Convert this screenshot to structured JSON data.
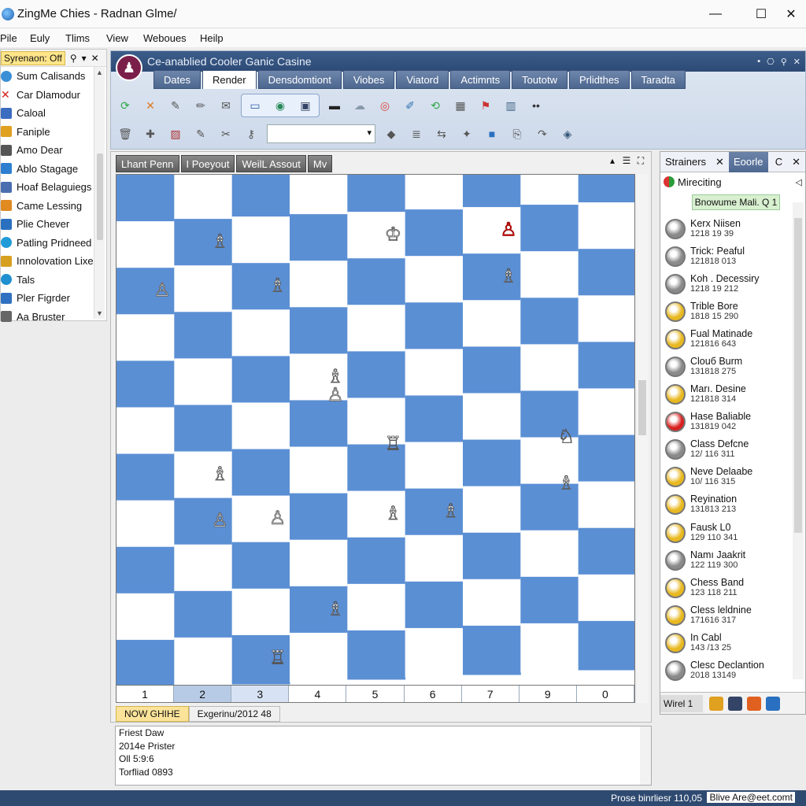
{
  "window": {
    "title": "ZingMe Chies - Radnan Glme/",
    "controls": [
      "—",
      "☐",
      "✕"
    ]
  },
  "menu": [
    "Pile",
    "Euly",
    "Tlims",
    "View",
    "Weboues",
    "Heilp"
  ],
  "left_panel": {
    "header_tag": "Syrenaon: Off",
    "header_controls": [
      "⚲",
      "▾",
      "✕"
    ],
    "items": [
      {
        "label": "Sum Calisands",
        "icon": "cloud-icon",
        "color": "#3b8fd6"
      },
      {
        "label": "Car Dlamodur",
        "icon": "cross-icon",
        "color": "#d02020"
      },
      {
        "label": "Caloal",
        "icon": "document-icon",
        "color": "#3a6cc0"
      },
      {
        "label": "Faniple",
        "icon": "folder-icon",
        "color": "#e0a020"
      },
      {
        "label": "Amo Dear",
        "icon": "person-icon",
        "color": "#555555"
      },
      {
        "label": "Ablo Stagage",
        "icon": "grid-icon",
        "color": "#2f7fd0"
      },
      {
        "label": "Hoaf Belaguiegs",
        "icon": "book-icon",
        "color": "#4a6fb0"
      },
      {
        "label": "Came Lessing",
        "icon": "game-icon",
        "color": "#e08a20"
      },
      {
        "label": "Plie Chever",
        "icon": "monitor-icon",
        "color": "#2a70c0"
      },
      {
        "label": "Patling Pridneed",
        "icon": "globe-icon",
        "color": "#1f9cd8"
      },
      {
        "label": "Innolovation Lixe",
        "icon": "star-icon",
        "color": "#d8a020"
      },
      {
        "label": "Tals",
        "icon": "globe-icon",
        "color": "#2090d0"
      },
      {
        "label": "Pler Figrder",
        "icon": "chart-icon",
        "color": "#3070c0"
      },
      {
        "label": "Aa Bruster",
        "icon": "pen-icon",
        "color": "#666666"
      }
    ]
  },
  "document": {
    "title": "Ce-anablied  Cooler Ganic Casine",
    "tabs": [
      "Dates",
      "Render",
      "Densdomtiont",
      "Viobes",
      "Viatord",
      "Actimnts",
      "Toutotw",
      "Prlidthes",
      "Taradta"
    ],
    "active_tab": "Render",
    "window_controls": [
      "▪",
      "⎔",
      "⚲",
      "✕"
    ]
  },
  "toolbar": {
    "row1": [
      {
        "icon": "refresh-icon",
        "color": "#2fa84a"
      },
      {
        "icon": "close-orange-icon",
        "color": "#e07a20"
      },
      {
        "icon": "brush-icon",
        "color": "#555555"
      },
      {
        "icon": "pencil-icon",
        "color": "#555555"
      },
      {
        "icon": "mail-icon",
        "color": "#555555"
      },
      {
        "icon": "window-icon",
        "color": "#3060b0"
      },
      {
        "icon": "globe-icon",
        "color": "#2a8a5a"
      },
      {
        "icon": "screen-icon",
        "color": "#334466"
      },
      {
        "icon": "monitor-icon",
        "color": "#222222"
      },
      {
        "icon": "cloud-icon",
        "color": "#8899aa"
      },
      {
        "icon": "chrome-icon",
        "color": "#db4437"
      },
      {
        "icon": "edit-icon",
        "color": "#2a6fb0"
      },
      {
        "icon": "green-box-icon",
        "color": "#2fa84a"
      },
      {
        "icon": "calculator-icon",
        "color": "#555555"
      },
      {
        "icon": "flag-icon",
        "color": "#cc3333"
      },
      {
        "icon": "table-icon",
        "color": "#446688"
      },
      {
        "icon": "more-icon",
        "color": "#333333"
      }
    ],
    "row2": [
      {
        "icon": "trash-icon",
        "color": "#555555"
      },
      {
        "icon": "puzzle-icon",
        "color": "#555555"
      },
      {
        "icon": "image-icon",
        "color": "#b03030"
      },
      {
        "icon": "brush-icon",
        "color": "#555555"
      },
      {
        "icon": "cut-icon",
        "color": "#555555"
      },
      {
        "icon": "key-icon",
        "color": "#555555"
      },
      {
        "icon": "paint-icon",
        "color": "#555555"
      },
      {
        "icon": "stack-icon",
        "color": "#555555"
      },
      {
        "icon": "flip-icon",
        "color": "#555555"
      },
      {
        "icon": "magic-icon",
        "color": "#555555"
      },
      {
        "icon": "cube-icon",
        "color": "#2a70c0"
      },
      {
        "icon": "paste-icon",
        "color": "#555555"
      },
      {
        "icon": "redo-icon",
        "color": "#555555"
      },
      {
        "icon": "bucket-icon",
        "color": "#335577"
      }
    ],
    "combo_value": ""
  },
  "board_window": {
    "tabs": [
      "Lhant Penn",
      "I Poeyout",
      "WeilL Assout",
      "Mv"
    ],
    "controls": [
      "▴",
      "☰",
      "⛶"
    ],
    "file_labels": [
      "1",
      "2",
      "3",
      "4",
      "5",
      "6",
      "7",
      "9",
      "0"
    ],
    "status_tabs": [
      "NOW GHIHE",
      "Exgerinu/2012 48"
    ],
    "active_status_tab": "NOW GHIHE"
  },
  "board": {
    "light_color": "#ffffff",
    "dark_color": "#5b8fd4",
    "pieces": [
      {
        "file": 0,
        "rank": 0,
        "type": "rook",
        "color": "#ffffff"
      },
      {
        "file": 0,
        "rank": 1,
        "type": "queen",
        "color": "#ffffff"
      },
      {
        "file": 0,
        "rank": 3,
        "type": "rook",
        "color": "#ffffff"
      },
      {
        "file": 0,
        "rank": 7,
        "type": "bishop",
        "color": "#ffffff"
      },
      {
        "file": 0,
        "rank": 9,
        "type": "bishop",
        "color": "#ffffff"
      },
      {
        "file": 1,
        "rank": 2,
        "type": "pawn",
        "color": "#ffffff"
      },
      {
        "file": 2,
        "rank": 1,
        "type": "bishop",
        "color": "#ffffff"
      },
      {
        "file": 2,
        "rank": 6,
        "type": "bishop",
        "color": "#ffffff"
      },
      {
        "file": 2,
        "rank": 7,
        "type": "pawn",
        "color": "#ffffff"
      },
      {
        "file": 3,
        "rank": 2,
        "type": "bishop",
        "color": "#ffffff"
      },
      {
        "file": 3,
        "rank": 7,
        "type": "pawn",
        "color": "#ffffff"
      },
      {
        "file": 3,
        "rank": 10,
        "type": "rook",
        "color": "#ffffff"
      },
      {
        "file": 4,
        "rank": 4,
        "type": "bishop",
        "color": "#ffffff"
      },
      {
        "file": 4,
        "rank": 4.4,
        "type": "pawn",
        "color": "#ffffff"
      },
      {
        "file": 4,
        "rank": 9,
        "type": "bishop",
        "color": "#ffffff"
      },
      {
        "file": 5,
        "rank": 1,
        "type": "king",
        "color": "#ffffff"
      },
      {
        "file": 5,
        "rank": 5.5,
        "type": "rook",
        "color": "#ffffff"
      },
      {
        "file": 5,
        "rank": 7,
        "type": "bishop",
        "color": "#ffffff"
      },
      {
        "file": 6,
        "rank": 7,
        "type": "bishop",
        "color": "#ffffff"
      },
      {
        "file": 7,
        "rank": 1,
        "type": "pawn",
        "color": "#d82020"
      },
      {
        "file": 7,
        "rank": 2,
        "type": "bishop",
        "color": "#ffffff"
      },
      {
        "file": 8,
        "rank": 5.5,
        "type": "knight",
        "color": "#ffffff"
      },
      {
        "file": 8,
        "rank": 6.5,
        "type": "bishop",
        "color": "#ffffff"
      }
    ]
  },
  "log": [
    "Friest Daw",
    "2014e Prister",
    "Oll 5:9:6",
    "Torfliad 0893"
  ],
  "right_panel": {
    "tabs": [
      "Strainers",
      "Eoorle"
    ],
    "tab_controls": [
      "✕",
      "C",
      "✕"
    ],
    "header": "Mireciting",
    "header_control": "◁",
    "chip": "Bnowume Mali. Q 1",
    "players": [
      {
        "name": "Kerx Niisen",
        "sub": "1218 19 39",
        "avatar": "#8a8a8a"
      },
      {
        "name": "Trick: Peaful",
        "sub": "121818 013",
        "avatar": "#8a8a8a"
      },
      {
        "name": "Koh . Decessiry",
        "sub": "1218 19 212",
        "avatar": "#8a8a8a"
      },
      {
        "name": "Trible Bore",
        "sub": "1818 15 290",
        "avatar": "#e8b820"
      },
      {
        "name": "Fual Matinade",
        "sub": "121816 643",
        "avatar": "#e8b820"
      },
      {
        "name": "Clouб Burm",
        "sub": "131818 275",
        "avatar": "#8a8a8a"
      },
      {
        "name": "Marı. Desine",
        "sub": "121818 314",
        "avatar": "#e8b820"
      },
      {
        "name": "Hase Baliable",
        "sub": "131819 042",
        "avatar": "#d82020"
      },
      {
        "name": "Class Defcne",
        "sub": "12/ 116 311",
        "avatar": "#8a8a8a"
      },
      {
        "name": "Neve Delaabe",
        "sub": "10/ 116 315",
        "avatar": "#e8b820"
      },
      {
        "name": "Reyination",
        "sub": "131813 213",
        "avatar": "#e8b820"
      },
      {
        "name": "Fausk L0",
        "sub": "129 110 341",
        "avatar": "#e8b820"
      },
      {
        "name": "Namı Jaakrit",
        "sub": "122 119 300",
        "avatar": "#8a8a8a"
      },
      {
        "name": "Chess Band",
        "sub": "123 118 211",
        "avatar": "#e8b820"
      },
      {
        "name": "Cless leldnine",
        "sub": "171616 317",
        "avatar": "#e8b820"
      },
      {
        "name": "In Cabl",
        "sub": "143 /13 25",
        "avatar": "#e8b820"
      },
      {
        "name": "Clesс Declantion",
        "sub": "2018 13149",
        "avatar": "#8a8a8a"
      }
    ],
    "bottom_tab": "Wirel 1",
    "bottom_icons": [
      {
        "icon": "image-icon",
        "color": "#e0a020"
      },
      {
        "icon": "globe-icon",
        "color": "#334466"
      },
      {
        "icon": "windows-icon",
        "color": "#e06020"
      },
      {
        "icon": "monitor-icon",
        "color": "#2a70c0"
      }
    ]
  },
  "statusbar": {
    "text": "Prose binrliesr 110,05",
    "mail": "Blive Are@eet.comt"
  }
}
